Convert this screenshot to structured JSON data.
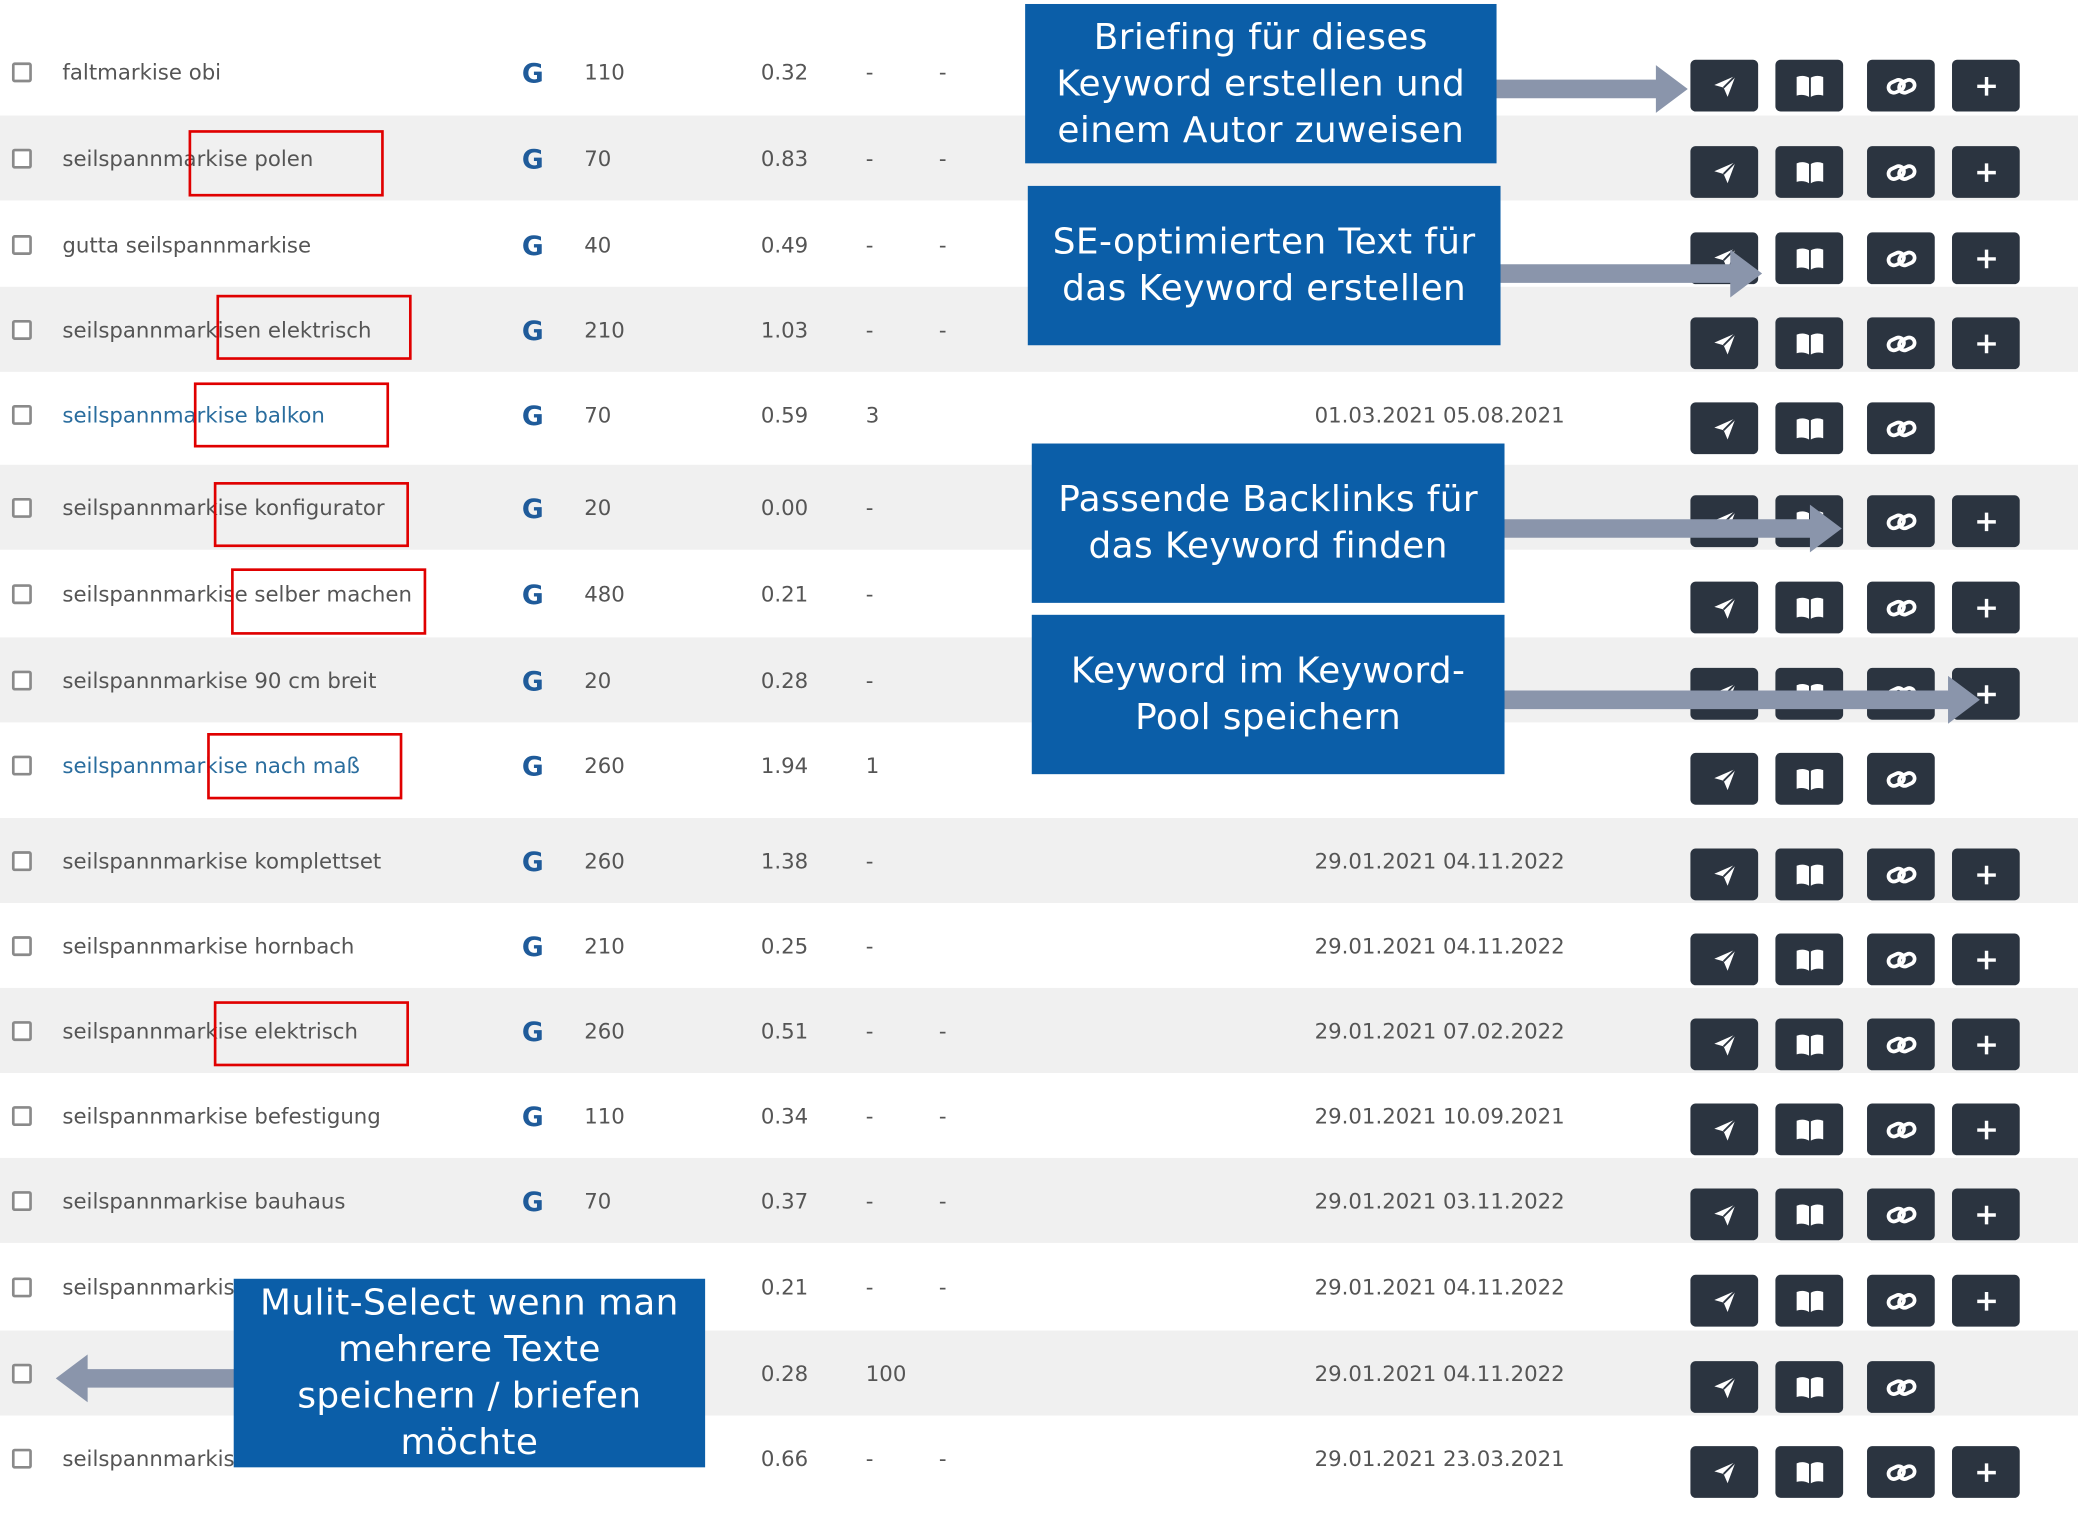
{
  "rows": [
    {
      "keyword": "faltmarkise obi",
      "search_engine": "G",
      "volume": "110",
      "cpc": "0.32",
      "col5": "-",
      "col6": "-",
      "dates": "",
      "link": false,
      "plus": true
    },
    {
      "keyword": "seilspannmarkise polen",
      "search_engine": "G",
      "volume": "70",
      "cpc": "0.83",
      "col5": "-",
      "col6": "-",
      "dates": "",
      "link": false,
      "plus": true
    },
    {
      "keyword": "gutta seilspannmarkise",
      "search_engine": "G",
      "volume": "40",
      "cpc": "0.49",
      "col5": "-",
      "col6": "-",
      "dates": "",
      "link": false,
      "plus": true
    },
    {
      "keyword": "seilspannmarkisen elektrisch",
      "search_engine": "G",
      "volume": "210",
      "cpc": "1.03",
      "col5": "-",
      "col6": "-",
      "dates": "",
      "link": false,
      "plus": true
    },
    {
      "keyword": "seilspannmarkise balkon",
      "search_engine": "G",
      "volume": "70",
      "cpc": "0.59",
      "col5": "3",
      "col6": "",
      "dates": "01.03.2021 05.08.2021",
      "link": true,
      "plus": false
    },
    {
      "keyword": "seilspannmarkise konfigurator",
      "search_engine": "G",
      "volume": "20",
      "cpc": "0.00",
      "col5": "-",
      "col6": "",
      "dates": "",
      "link": false,
      "plus": true
    },
    {
      "keyword": "seilspannmarkise selber machen",
      "search_engine": "G",
      "volume": "480",
      "cpc": "0.21",
      "col5": "-",
      "col6": "",
      "dates": "",
      "link": false,
      "plus": true
    },
    {
      "keyword": "seilspannmarkise 90 cm breit",
      "search_engine": "G",
      "volume": "20",
      "cpc": "0.28",
      "col5": "-",
      "col6": "",
      "dates": "",
      "link": false,
      "plus": true
    },
    {
      "keyword": "seilspannmarkise nach maß",
      "search_engine": "G",
      "volume": "260",
      "cpc": "1.94",
      "col5": "1",
      "col6": "",
      "dates": "",
      "link": true,
      "plus": false
    },
    {
      "keyword": "seilspannmarkise komplettset",
      "search_engine": "G",
      "volume": "260",
      "cpc": "1.38",
      "col5": "-",
      "col6": "",
      "dates": "29.01.2021 04.11.2022",
      "link": false,
      "plus": true
    },
    {
      "keyword": "seilspannmarkise hornbach",
      "search_engine": "G",
      "volume": "210",
      "cpc": "0.25",
      "col5": "-",
      "col6": "",
      "dates": "29.01.2021 04.11.2022",
      "link": false,
      "plus": true
    },
    {
      "keyword": "seilspannmarkise elektrisch",
      "search_engine": "G",
      "volume": "260",
      "cpc": "0.51",
      "col5": "-",
      "col6": "-",
      "dates": "29.01.2021 07.02.2022",
      "link": false,
      "plus": true
    },
    {
      "keyword": "seilspannmarkise befestigung",
      "search_engine": "G",
      "volume": "110",
      "cpc": "0.34",
      "col5": "-",
      "col6": "-",
      "dates": "29.01.2021 10.09.2021",
      "link": false,
      "plus": true
    },
    {
      "keyword": "seilspannmarkise bauhaus",
      "search_engine": "G",
      "volume": "70",
      "cpc": "0.37",
      "col5": "-",
      "col6": "-",
      "dates": "29.01.2021 03.11.2022",
      "link": false,
      "plus": true
    },
    {
      "keyword": "seilspannmarkis",
      "search_engine": "",
      "volume": "",
      "cpc": "0.21",
      "col5": "-",
      "col6": "-",
      "dates": "29.01.2021 04.11.2022",
      "link": false,
      "plus": true
    },
    {
      "keyword": "",
      "search_engine": "",
      "volume": "",
      "cpc": "0.28",
      "col5": "100",
      "col6": "",
      "dates": "29.01.2021 04.11.2022",
      "link": false,
      "plus": false
    },
    {
      "keyword": "seilspannmarkis",
      "search_engine": "",
      "volume": "",
      "cpc": "0.66",
      "col5": "-",
      "col6": "-",
      "dates": "29.01.2021 23.03.2021",
      "link": false,
      "plus": true
    }
  ],
  "callouts": {
    "briefing": "Briefing für dieses Keyword erstellen und einem Autor zuweisen",
    "text": "SE-optimierten Text für das Keyword erstellen",
    "backlinks": "Passende Backlinks für das Keyword finden",
    "pool": "Keyword im Keyword-Pool speichern",
    "multiselect": "Mulit-Select wenn man mehrere Texte speichern / briefen möchte"
  },
  "colors": {
    "callout_bg": "#0b5ea8",
    "button_bg": "#2b3440",
    "highlight_border": "#e00000",
    "link_text": "#2a6d9e",
    "google_icon": "#1f5b9a",
    "arrow": "#8a95ab"
  },
  "icons": [
    "send-icon",
    "book-icon",
    "link-icon",
    "plus-icon",
    "google-g-icon"
  ]
}
